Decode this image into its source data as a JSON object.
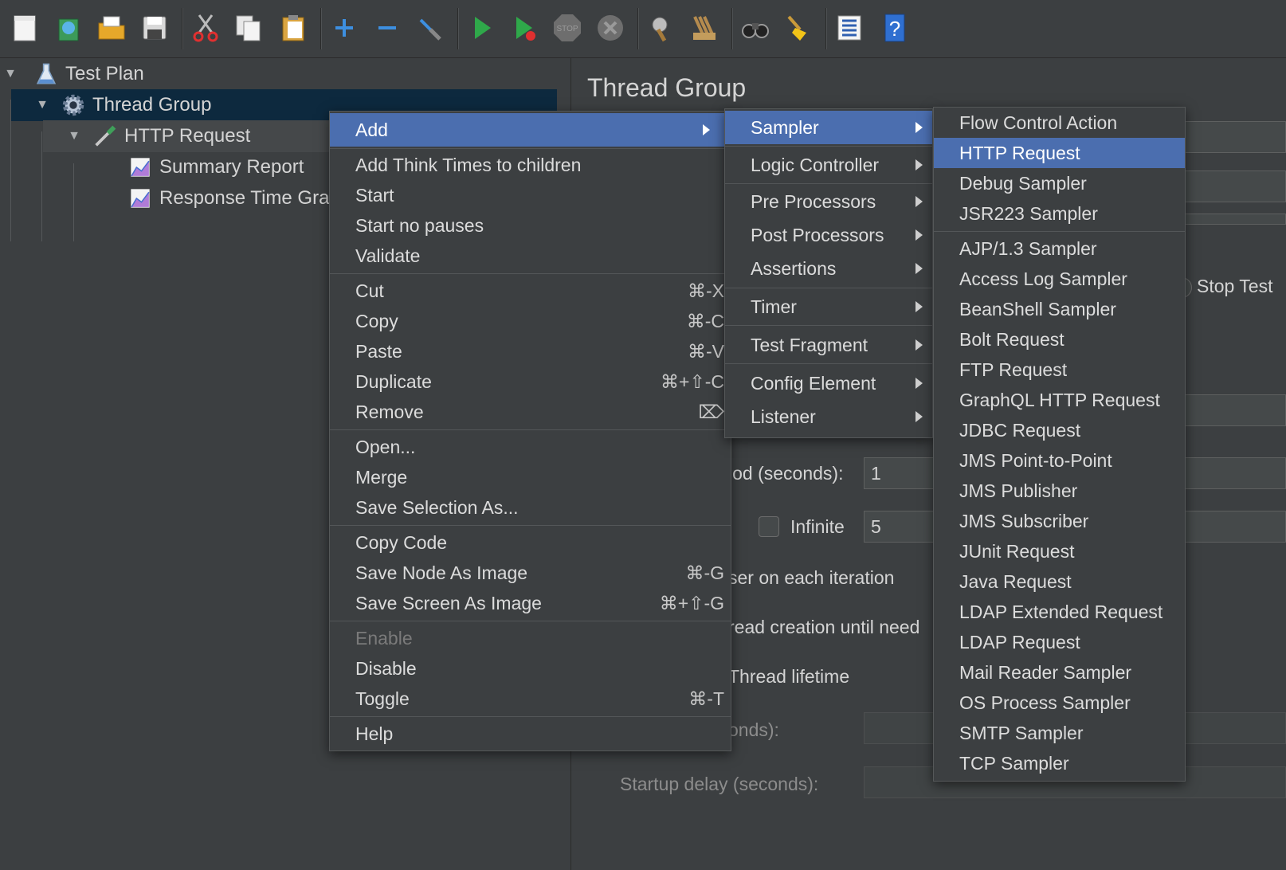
{
  "toolbar": {
    "icons": [
      "new-icon",
      "templates-icon",
      "open-icon",
      "save-icon",
      "cut-icon",
      "copy-icon",
      "paste-icon",
      "expand-icon",
      "collapse-icon",
      "toggle-icon",
      "start-icon",
      "start-no-pauses-icon",
      "stop-icon",
      "shutdown-icon",
      "clear-icon",
      "clear-all-icon",
      "search-icon",
      "reset-search-icon",
      "function-helper-icon",
      "help-icon"
    ]
  },
  "tree": {
    "items": [
      {
        "label": "Test Plan",
        "icon": "flask-icon"
      },
      {
        "label": "Thread Group",
        "icon": "gear-icon"
      },
      {
        "label": "HTTP Request",
        "icon": "pipette-icon"
      },
      {
        "label": "Summary Report",
        "icon": "graph-icon"
      },
      {
        "label": "Response Time Gra",
        "icon": "graph-icon"
      }
    ]
  },
  "content": {
    "title": "Thread Group",
    "stop_test": "Stop Test",
    "ramp_label": "iod (seconds):",
    "ramp_value": "1",
    "infinite_label": "Infinite",
    "loop_value": "5",
    "same_user": "ser on each iteration",
    "delay_creation": "read creation until need",
    "thread_lifetime": "Thread lifetime",
    "duration_label": "onds):",
    "startup_delay": "Startup delay (seconds):"
  },
  "context_menu": {
    "add": "Add",
    "add_think_times": "Add Think Times to children",
    "start": "Start",
    "start_no_pauses": "Start no pauses",
    "validate": "Validate",
    "cut": "Cut",
    "cut_sc": "⌘-X",
    "copy": "Copy",
    "copy_sc": "⌘-C",
    "paste": "Paste",
    "paste_sc": "⌘-V",
    "duplicate": "Duplicate",
    "duplicate_sc": "⌘+⇧-C",
    "remove": "Remove",
    "remove_sc": "⌦",
    "open": "Open...",
    "merge": "Merge",
    "save_selection": "Save Selection As...",
    "copy_code": "Copy Code",
    "save_node_image": "Save Node As Image",
    "save_node_image_sc": "⌘-G",
    "save_screen_image": "Save Screen As Image",
    "save_screen_image_sc": "⌘+⇧-G",
    "enable": "Enable",
    "disable": "Disable",
    "toggle": "Toggle",
    "toggle_sc": "⌘-T",
    "help": "Help"
  },
  "add_submenu": {
    "sampler": "Sampler",
    "logic_controller": "Logic Controller",
    "pre_processors": "Pre Processors",
    "post_processors": "Post Processors",
    "assertions": "Assertions",
    "timer": "Timer",
    "test_fragment": "Test Fragment",
    "config_element": "Config Element",
    "listener": "Listener"
  },
  "sampler_submenu": {
    "items": [
      "Flow Control Action",
      "HTTP Request",
      "Debug Sampler",
      "JSR223 Sampler",
      "AJP/1.3 Sampler",
      "Access Log Sampler",
      "BeanShell Sampler",
      "Bolt Request",
      "FTP Request",
      "GraphQL HTTP Request",
      "JDBC Request",
      "JMS Point-to-Point",
      "JMS Publisher",
      "JMS Subscriber",
      "JUnit Request",
      "Java Request",
      "LDAP Extended Request",
      "LDAP Request",
      "Mail Reader Sampler",
      "OS Process Sampler",
      "SMTP Sampler",
      "TCP Sampler"
    ],
    "selected": "HTTP Request"
  },
  "colors": {
    "background": "#3c3f41",
    "menu_highlight": "#4b6eaf",
    "tree_selection": "#0d293e"
  }
}
